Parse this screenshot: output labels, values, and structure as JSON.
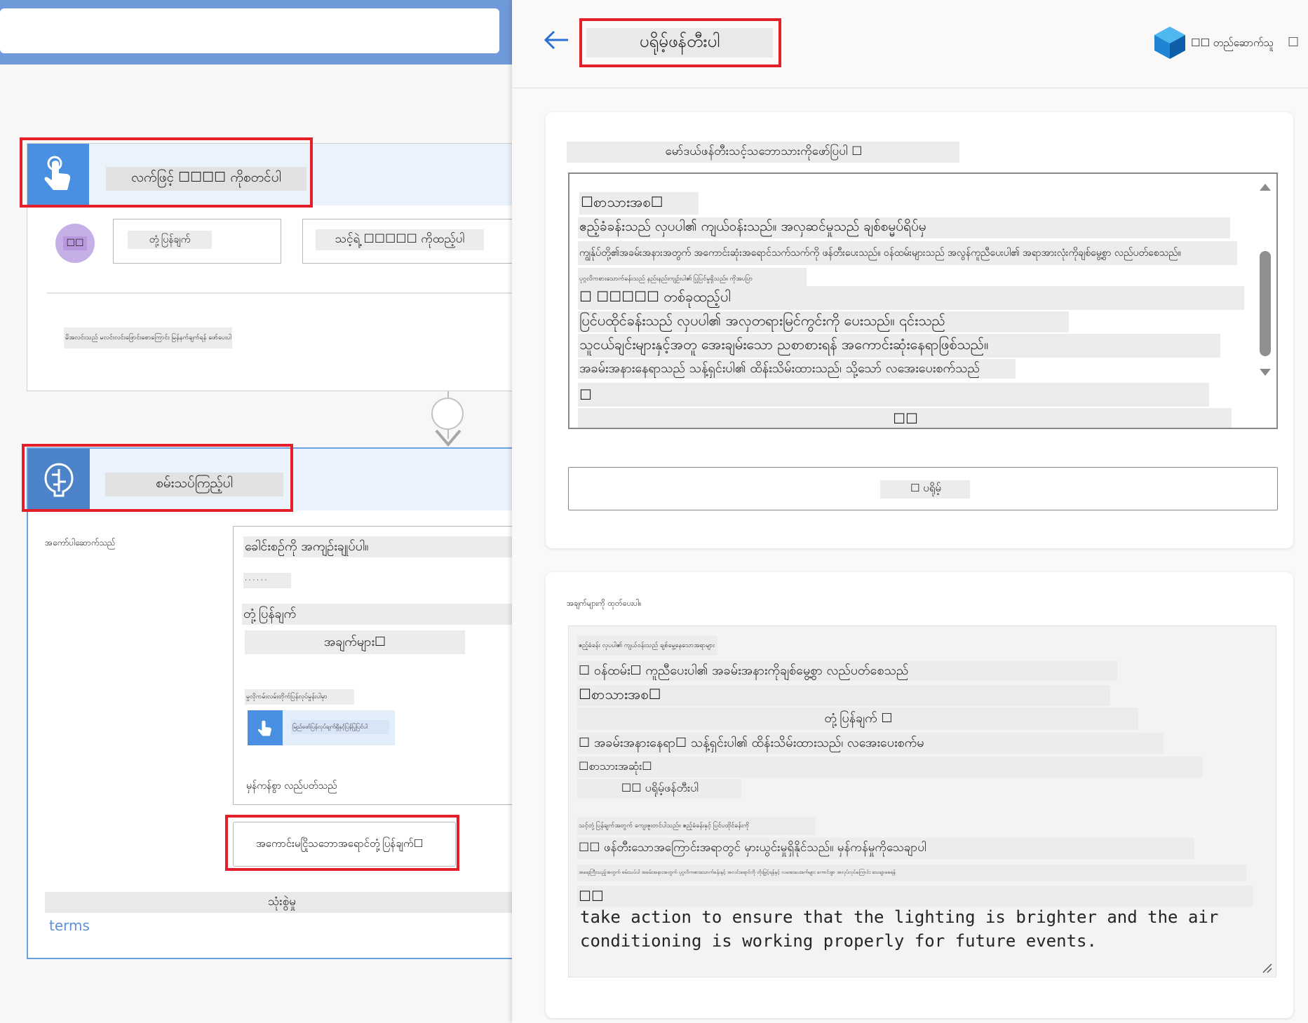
{
  "left": {
    "trigger": {
      "title": "လက်ဖြင့် ☐☐☐☐ ကိုစတင်ပါ",
      "avatar": "☐☐",
      "input1": "တုံ့ပြန်ချက်",
      "input2": "သင့်ရဲ့ ☐☐☐☐☐ ကိုထည့်ပါ",
      "helper": "မိအလင်းသည် မလင်းလင်းဖြောင်းစောကြောင်း မြန်နက်ချက်ရန် ဖော်ပေးပါ"
    },
    "ai_step": {
      "title": "စမ်းသပ်ကြည့်ပါ",
      "label": "အကော်ပါဆောက်သည်",
      "prompt_title": "ခေါင်းစဉ်ကို အကျဉ်းချုပ်ပါ။",
      "prompt_small": "· · · · · ·",
      "feedback": "တုံ့ပြန်ချက်",
      "details": "အချက်များ☐",
      "chip_caption": "မှုလိုကမ်းလမ်းတိုက်ပြန်လုပ်မှုန်းပါမှာ",
      "chip_text": "မြည်ဖော်ပြန်လုပ်ချက်ရှိနှင့်ပြန်ပြုပြင်ပါ",
      "footer": "မှန်ကန်စွာ လည်ပတ်သည်"
    },
    "output_button": "အကောင်းမငြိုသဘောအရောင်တုံ့ပြန်ချက်☐",
    "usage_label": "သုံးစွဲမှု",
    "terms_link": "terms"
  },
  "right": {
    "title": "ပရိုမ့်ဖန်တီးပါ",
    "env_label": "☐☐ တည်ဆောက်သူ",
    "menu_glyph": "☐",
    "prompt_panel": {
      "instruction": "မော်ဒယ်ဖန်တီးသင့်သဘောသားကိုဖော်ပြပါ ☐",
      "lines": [
        "☐စာသားအစ☐",
        "ဧည့်ခံခန်းသည် လှပပါ၏ ကျယ်ဝန်းသည်။ အလှဆင်မှုသည် ချစ်စမ္မပ်ရိပ်မှ",
        "ကျွန်ုပ်တို့၏အခမ်းအနားအတွက် အကောင်းဆုံးအရောင်သက်သက်ကို ဖန်တီးပေးသည်။ ဝန်ထမ်းများသည် အလွန်ကူညီပေးပါ၏ အရာအားလုံးကိုချစ်မွေ့စွာ လည်ပတ်စေသည်။",
        "ပုဂ္ဂလိကစားသောက်ခန်းသည် နည်းနည်းကျဉ်းပါ၏ ပြုပြင်မှုရှိသည်။ ကိုအပပြာ",
        "☐ ☐☐☐☐☐ တစ်ခုထည့်ပါ",
        "ပြင်ပထိုင်ခန်းသည် လှပပါ၏ အလှတရားမြင်ကွင်းကို ပေးသည်။ ၎င်းသည်",
        "သူငယ်ချင်းများနှင့်အတူ အေးချမ်းသော ညစာစားရန် အကောင်းဆုံးနေရာဖြစ်သည်။",
        "အခမ်းအနားနေရာသည် သန့်ရှင်းပါ၏ ထိန်းသိမ်းထားသည်၊ သို့သော် လအေးပေးစက်သည်",
        "☐",
        "☐☐"
      ],
      "test_button": "☐ ပရိုမ့်"
    },
    "output_panel": {
      "title": "အချက်များကို ထုတ်ပေးပါ။",
      "lines": [
        "ဧည့်ခံခန်း လှပပါ၏ ကျယ်ဝန်းသည် ချစ်မွေ့နေသောအရာများ",
        "☐ ဝန်ထမ်း☐ ကူညီပေးပါ၏ အခမ်းအနားကိုချစ်မွေ့စွာ လည်ပတ်စေသည်",
        "☐စာသားအစ☐",
        "တုံ့ပြန်ချက် ☐",
        "☐ အခမ်းအနားနေရာ☐ သန့်ရှင်းပါ၏ ထိန်းသိမ်းထားသည်၊ လအေးပေးစက်မ",
        "☐စာသားအဆုံး☐",
        "☐☐ ပရိုမ့်ဖန်တီးပါ",
        "သင့်တုံ့ပြန်ချက်အတွက် ကျေးဇူးတင်ပါသည်။ ဧည့်ခံခန်းနှင့် ပြင်ပထိုင်ခန်းကို",
        "☐☐ ဖန်တီးသောအကြောင်းအရာတွင် မှားယွင်းမှုရှိနိုင်သည်။ မှန်ကန်မှုကိုသေချာပါ",
        "အရေးကြီးသည့်အတွက် စမ်းသပ်ပါ အခမ်းအနားအတွက် ပုဂ္ဂလိကစားသောက်ခန်းနှင့် အလင်းရောင်ကို တိုးမြှင့်ရန်နှင့် လအေးပေးစက်များ ကောင်းစွာ အလုပ်လုပ်ကြောင်း သေချာစေရန်",
        "☐☐"
      ],
      "tail_text": "take action to ensure that the lighting is brighter and the air conditioning is working properly for future events."
    }
  }
}
